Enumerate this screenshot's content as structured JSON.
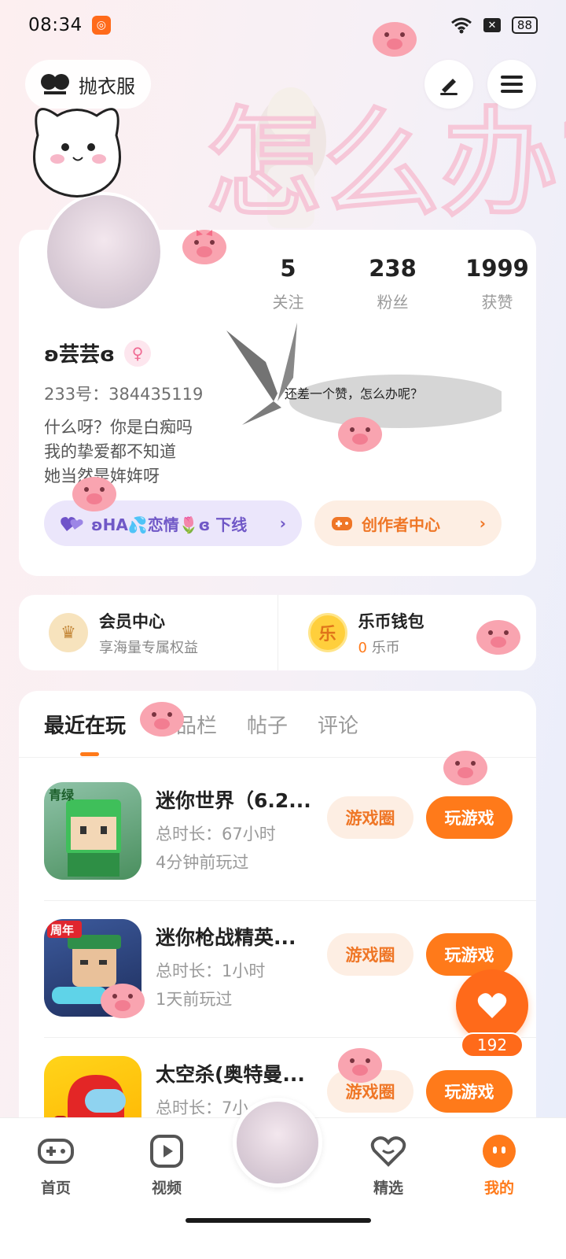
{
  "status_bar": {
    "time": "08:34",
    "battery": "88"
  },
  "header": {
    "nickname_partial": "抛衣服"
  },
  "banner": {
    "overlay_text": "怎么办?"
  },
  "profile": {
    "stats": [
      {
        "value": "5",
        "label": "关注"
      },
      {
        "value": "238",
        "label": "粉丝"
      },
      {
        "value": "1999",
        "label": "获赞"
      }
    ],
    "name": "ʚ芸芸ɞ",
    "gender_symbol": "♀",
    "id_line": "233号：384435119",
    "bio_lines": [
      "什么呀？你是白痴吗",
      "我的挚爱都不知道",
      "她当然是姩姩呀"
    ],
    "butterfly_caption": "还差一个赞，怎么办呢？",
    "family_pill": "ʚHA💦恋情🌷ɞ 下线",
    "creator_pill": "创作者中心"
  },
  "membership": {
    "member_title": "会员中心",
    "member_sub": "享海量专属权益",
    "coin_icon_text": "乐",
    "wallet_title": "乐币钱包",
    "wallet_count": "0",
    "wallet_unit": "乐币"
  },
  "tabs": [
    {
      "label": "最近在玩",
      "active": true
    },
    {
      "label": "作品栏",
      "active": false
    },
    {
      "label": "帖子",
      "active": false
    },
    {
      "label": "评论",
      "active": false
    }
  ],
  "games": [
    {
      "title": "迷你世界（6.2...",
      "duration": "总时长：67小时",
      "last_played": "4分钟前玩过",
      "circle_btn": "游戏圈",
      "play_btn": "玩游戏",
      "icon_badge": "青绿"
    },
    {
      "title": "迷你枪战精英...",
      "duration": "总时长：1小时",
      "last_played": "1天前玩过",
      "circle_btn": "游戏圈",
      "play_btn": "玩游戏",
      "icon_badge": "周年"
    },
    {
      "title": "太空杀(奥特曼...",
      "duration": "总时长：7小",
      "last_played": "",
      "circle_btn": "游戏圈",
      "play_btn": "玩游戏",
      "icon_badge": ""
    }
  ],
  "like_fab": {
    "count": "192"
  },
  "bottom_nav": [
    {
      "label": "首页",
      "icon": "gamepad-icon"
    },
    {
      "label": "视频",
      "icon": "video-play-icon"
    },
    {
      "label": "精选",
      "icon": "heart-featured-icon"
    },
    {
      "label": "我的",
      "icon": "profile-face-icon"
    }
  ],
  "colors": {
    "accent": "#ff7a1a",
    "purple_pill": "#ebe6fb",
    "orange_pill": "#fdeee3"
  }
}
